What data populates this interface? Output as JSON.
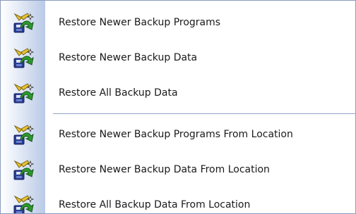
{
  "menu": {
    "group1": [
      {
        "label": "Restore Newer Backup Programs",
        "icon": "restore-programs-icon"
      },
      {
        "label": "Restore Newer Backup Data",
        "icon": "restore-data-icon"
      },
      {
        "label": "Restore All Backup Data",
        "icon": "restore-all-icon"
      }
    ],
    "group2": [
      {
        "label": "Restore Newer Backup Programs From Location",
        "icon": "restore-programs-icon"
      },
      {
        "label": "Restore Newer Backup Data From Location",
        "icon": "restore-data-icon"
      },
      {
        "label": "Restore All Backup Data From Location",
        "icon": "restore-all-icon"
      }
    ]
  },
  "colors": {
    "border": "#8a9bbd",
    "gutter": "#b9c9e6",
    "separator": "#8ea3c8",
    "arrow_green": "#2e9a2e",
    "disk_blue": "#2a3d8f",
    "arm_yellow": "#e8c233"
  }
}
